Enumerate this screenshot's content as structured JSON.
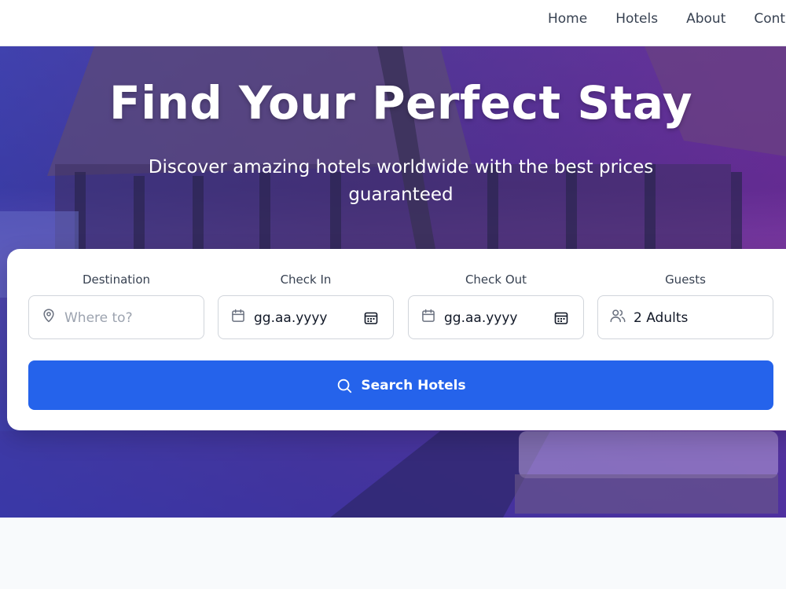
{
  "nav": {
    "items": [
      {
        "label": "Home"
      },
      {
        "label": "Hotels"
      },
      {
        "label": "About"
      },
      {
        "label": "Conta"
      }
    ]
  },
  "hero": {
    "title": "Find Your Perfect Stay",
    "subtitle": "Discover amazing hotels worldwide with the best prices guaranteed"
  },
  "search": {
    "destination": {
      "label": "Destination",
      "placeholder": "Where to?",
      "icon": "map-pin-icon"
    },
    "check_in": {
      "label": "Check In",
      "value": "gg.aa.yyyy",
      "icon": "calendar-icon"
    },
    "check_out": {
      "label": "Check Out",
      "value": "gg.aa.yyyy",
      "icon": "calendar-icon"
    },
    "guests": {
      "label": "Guests",
      "value": "2 Adults",
      "icon": "users-icon"
    },
    "button_label": "Search Hotels"
  },
  "colors": {
    "accent": "#2563eb",
    "hero_overlay": "#4f46e5"
  }
}
